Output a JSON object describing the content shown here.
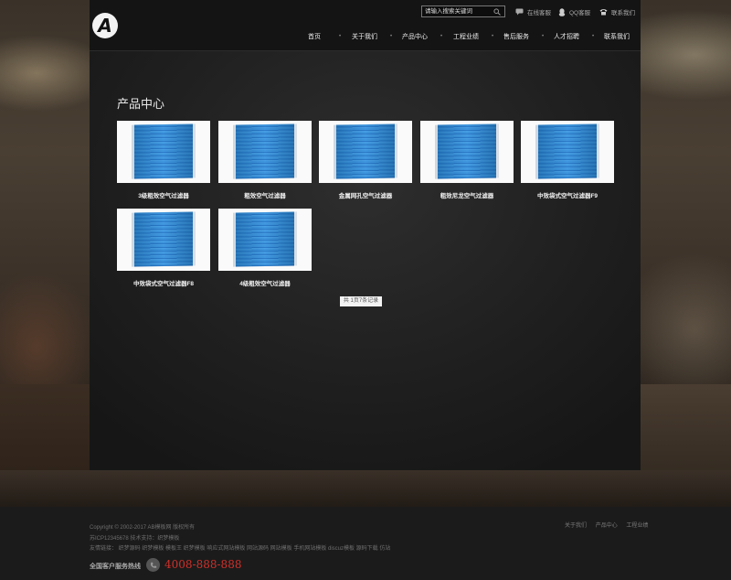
{
  "header": {
    "search_placeholder": "请输入搜索关键词",
    "top_links": [
      {
        "label": "在线客服",
        "icon": "chat-icon"
      },
      {
        "label": "QQ客服",
        "icon": "qq-penguin-icon"
      },
      {
        "label": "联系我们",
        "icon": "phone-icon"
      }
    ],
    "nav": [
      "首页",
      "关于我们",
      "产品中心",
      "工程业绩",
      "售后服务",
      "人才招聘",
      "联系我们"
    ],
    "nav_separator": "•"
  },
  "main": {
    "title": "产品中心",
    "products": [
      {
        "name": "3级粗效空气过滤器"
      },
      {
        "name": "粗效空气过滤器"
      },
      {
        "name": "金属网孔空气过滤器"
      },
      {
        "name": "粗效尼龙空气过滤器"
      },
      {
        "name": "中效袋式空气过滤器F9"
      },
      {
        "name": "中效袋式空气过滤器F8"
      },
      {
        "name": "4级粗效空气过滤器"
      }
    ],
    "pager": "共 1页7条记录"
  },
  "footer": {
    "copyright": "Copyright © 2002-2017 AB模板网 版权所有",
    "icp": "苏ICP12345678  技术支持：织梦模板",
    "friend_links": "友情链接： 织梦源码 织梦模板 模板王 织梦模板 响应式网站模板 网站源码 网站模板 手机网站模板 discuz模板 源码下载 仿站",
    "links": [
      "关于我们",
      "产品中心",
      "工程业绩"
    ],
    "hotline_label": "全国客户服务热线",
    "hotline": "4008-888-888"
  },
  "colors": {
    "hotline": "#d0302a",
    "filter_blue": "#2f8ddb"
  }
}
